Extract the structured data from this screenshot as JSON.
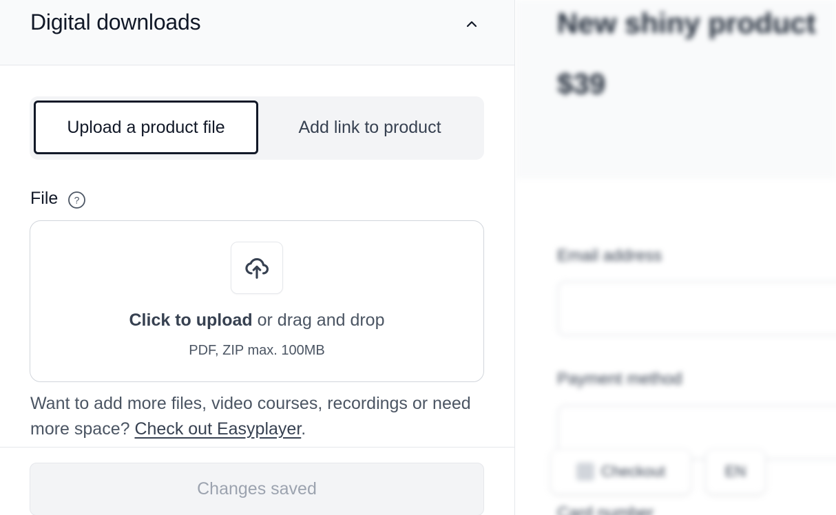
{
  "panel": {
    "title": "Digital downloads"
  },
  "tabs": {
    "upload_label": "Upload a product file",
    "link_label": "Add link to product"
  },
  "file": {
    "label": "File"
  },
  "dropzone": {
    "click_text": "Click to upload",
    "drag_text": " or drag and drop",
    "hint": "PDF, ZIP max. 100MB"
  },
  "more": {
    "text": "Want to add more files, video courses, recordings or need more space? ",
    "link_text": "Check out Easyplayer",
    "suffix": "."
  },
  "footer": {
    "saved_label": "Changes saved"
  },
  "preview": {
    "title": "New shiny product",
    "price": "$39",
    "email_label": "Email address",
    "payment_label": "Payment method",
    "checkout_label": "Checkout",
    "lang_label": "EN",
    "card_label": "Card number"
  },
  "colors": {
    "accent": "#111827",
    "muted": "#9ca3af",
    "panel_bg": "#f9fafb",
    "segment_bg": "#f3f4f6"
  }
}
